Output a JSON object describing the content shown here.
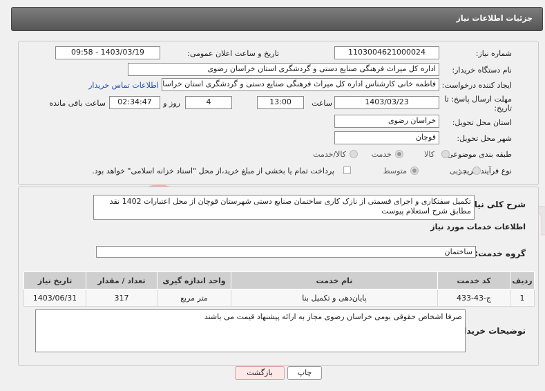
{
  "header": {
    "title": "جزئیات اطلاعات نیاز"
  },
  "need": {
    "number_label": "شماره نیاز:",
    "number_value": "1103004621000024",
    "announce_label": "تاریخ و ساعت اعلان عمومی:",
    "announce_value": "1403/03/19 - 09:58",
    "buyer_label": "نام دستگاه خریدار:",
    "buyer_value": "اداره کل میراث فرهنگی  صنایع دستی و گردشگری استان خراسان رضوی",
    "creator_label": "ایجاد کننده درخواست:",
    "creator_value": "فاطمه خانی کارشناس اداره کل میراث فرهنگی  صنایع دستی و گردشگری استان خراسان رضوی",
    "contact_link": "اطلاعات تماس خریدار",
    "deadline_label": "مهلت ارسال پاسخ: تا تاریخ:",
    "deadline_date": "1403/03/23",
    "time_label": "ساعت",
    "deadline_time": "13:00",
    "days_value": "4",
    "days_label": "روز و",
    "remaining_time": "02:34:47",
    "remaining_label": "ساعت باقی مانده",
    "province_label": "استان محل تحویل:",
    "province_value": "خراسان رضوی",
    "city_label": "شهر محل تحویل:",
    "city_value": "قوچان",
    "category_label": "طبقه بندی موضوعی:",
    "category_options": [
      "کالا",
      "خدمت",
      "کالا/خدمت"
    ],
    "process_label": "نوع فرآیند خرید :",
    "process_options": [
      "جزیی",
      "متوسط"
    ],
    "payment_note": "پرداخت تمام یا بخشی از مبلغ خرید،از محل \"اسناد خزانه اسلامی\" خواهد بود."
  },
  "description": {
    "label": "شرح کلی نیاز:",
    "value": "تکمیل سفتکاری و اجرای قسمتی از نازک کاری ساختمان صنایع دستی شهرستان قوچان از محل اعتبارات 1402 نقد مطابق شرح استعلام پیوست"
  },
  "services": {
    "section_title": "اطلاعات خدمات مورد نیاز",
    "group_label": "گروه خدمت:",
    "group_value": "ساختمان",
    "columns": [
      "ردیف",
      "کد خدمت",
      "نام خدمت",
      "واحد اندازه گیری",
      "تعداد / مقدار",
      "تاریخ نیاز"
    ],
    "rows": [
      {
        "row": "1",
        "code": "ج-43-433",
        "name": "پایان‌دهی و تکمیل بنا",
        "unit": "متر مربع",
        "qty": "317",
        "date": "1403/06/31"
      }
    ]
  },
  "buyer_notes": {
    "label": "توضیحات خریدار:",
    "value": "صرفا اشخاص حقوقی بومی خراسان رضوی مجاز به ارائه پیشنهاد قیمت می باشند"
  },
  "buttons": {
    "print": "چاپ",
    "back": "بازگشت"
  },
  "watermark": {
    "text": "AriaTender.neT"
  }
}
